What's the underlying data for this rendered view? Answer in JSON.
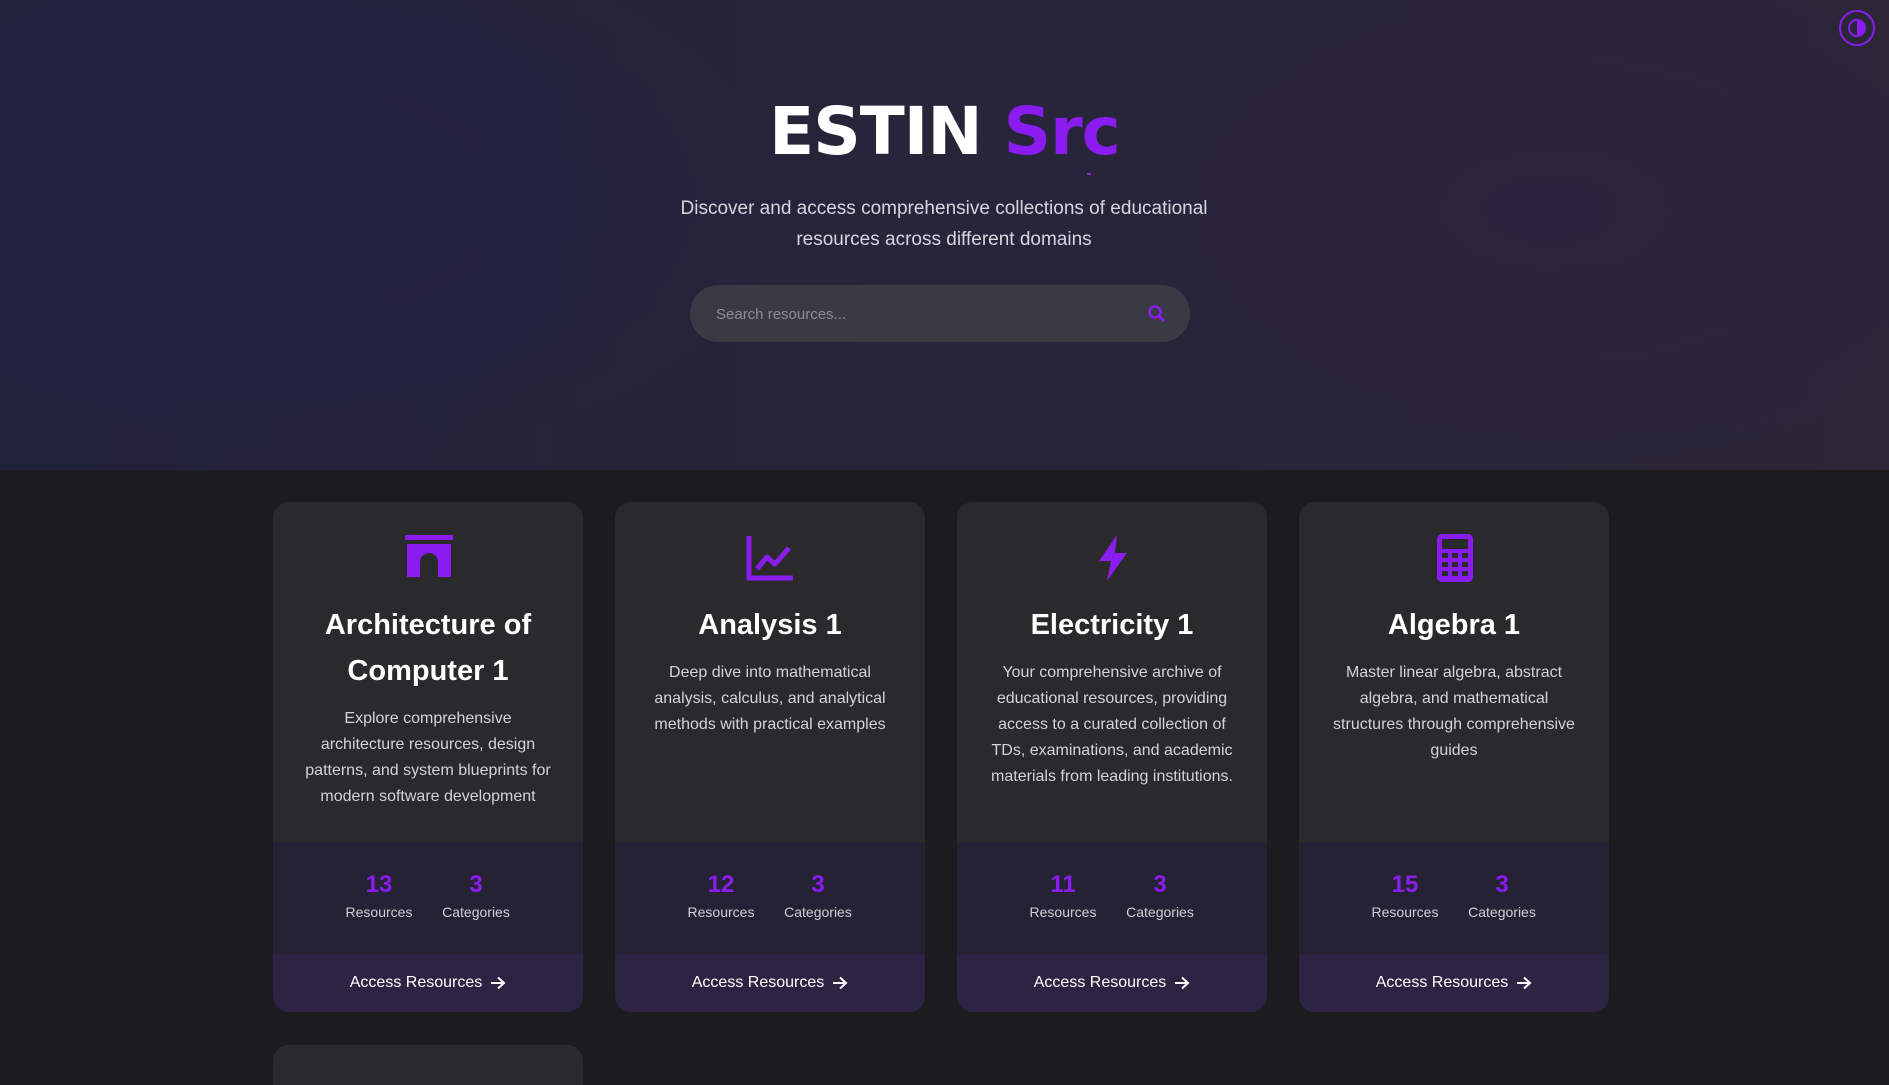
{
  "header": {
    "title_main": "ESTIN",
    "title_accent": "Src",
    "subtitle": "Discover and access comprehensive collections of educational resources across different domains",
    "theme_toggle_icon": "contrast-icon"
  },
  "search": {
    "placeholder": "Search resources...",
    "value": "",
    "icon": "search-icon"
  },
  "colors": {
    "accent": "#8a1cf0",
    "background": "#1c1c1e",
    "card": "#2a2a2c",
    "stats_panel": "#262235",
    "access_bar": "#2d2444"
  },
  "cards": [
    {
      "icon": "archway-icon",
      "title": "Architecture of Computer 1",
      "description": "Explore comprehensive architecture resources, design patterns, and system blueprints for modern software development",
      "resources_count": "13",
      "resources_label": "Resources",
      "categories_count": "3",
      "categories_label": "Categories",
      "action_label": "Access Resources"
    },
    {
      "icon": "chart-line-icon",
      "title": "Analysis 1",
      "description": "Deep dive into mathematical analysis, calculus, and analytical methods with practical examples",
      "resources_count": "12",
      "resources_label": "Resources",
      "categories_count": "3",
      "categories_label": "Categories",
      "action_label": "Access Resources"
    },
    {
      "icon": "bolt-icon",
      "title": "Electricity 1",
      "description": "Your comprehensive archive of educational resources, providing access to a curated collection of TDs, examinations, and academic materials from leading institutions.",
      "resources_count": "11",
      "resources_label": "Resources",
      "categories_count": "3",
      "categories_label": "Categories",
      "action_label": "Access Resources"
    },
    {
      "icon": "calculator-icon",
      "title": "Algebra 1",
      "description": "Master linear algebra, abstract algebra, and mathematical structures through comprehensive guides",
      "resources_count": "15",
      "resources_label": "Resources",
      "categories_count": "3",
      "categories_label": "Categories",
      "action_label": "Access Resources"
    }
  ]
}
